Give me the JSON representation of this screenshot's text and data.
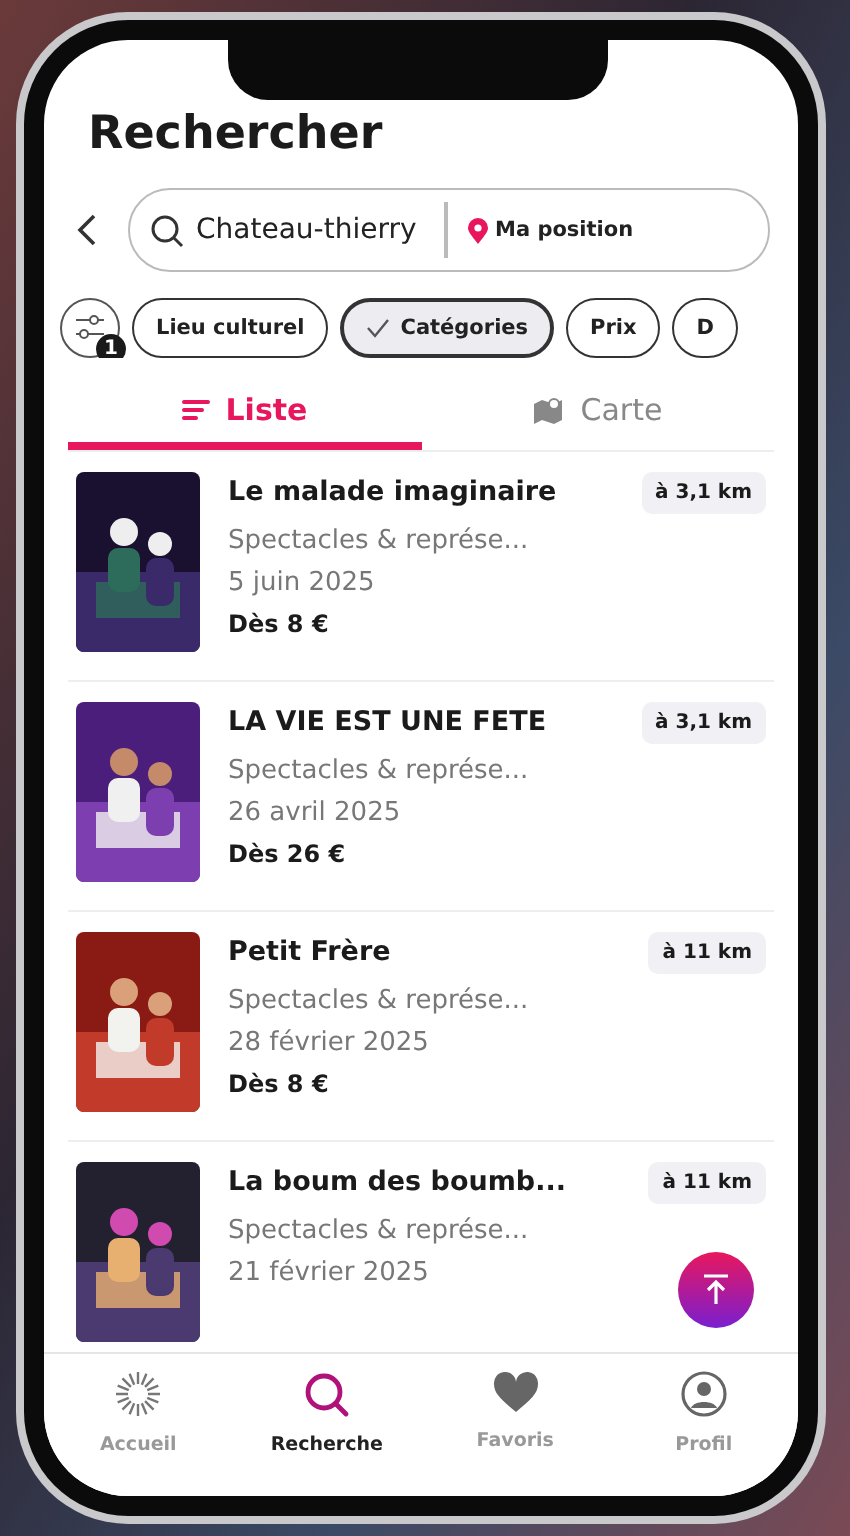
{
  "header": {
    "title": "Rechercher"
  },
  "search": {
    "value": "Chateau-thierry",
    "location_button": "Ma position"
  },
  "filters": {
    "badge": "1",
    "chips": [
      {
        "label": "Lieu culturel",
        "selected": false
      },
      {
        "label": "Catégories",
        "selected": true
      },
      {
        "label": "Prix",
        "selected": false
      },
      {
        "label": "D",
        "selected": false
      }
    ]
  },
  "tabs": [
    {
      "label": "Liste",
      "selected": true
    },
    {
      "label": "Carte",
      "selected": false
    }
  ],
  "results": [
    {
      "title": "Le malade imaginaire",
      "category": "Spectacles & représe...",
      "date": "5 juin 2025",
      "price": "Dès 8 €",
      "distance": "à 3,1 km"
    },
    {
      "title": "LA VIE EST UNE FETE",
      "category": "Spectacles & représe...",
      "date": "26 avril 2025",
      "price": "Dès 26 €",
      "distance": "à 3,1 km"
    },
    {
      "title": "Petit Frère",
      "category": "Spectacles & représe...",
      "date": "28 février 2025",
      "price": "Dès 8 €",
      "distance": "à 11 km"
    },
    {
      "title": "La boum des boumb...",
      "category": "Spectacles & représe...",
      "date": "21 février 2025",
      "distance": "à 11 km"
    }
  ],
  "nav": [
    {
      "label": "Accueil",
      "selected": false
    },
    {
      "label": "Recherche",
      "selected": true
    },
    {
      "label": "Favoris",
      "selected": false
    },
    {
      "label": "Profil",
      "selected": false
    }
  ]
}
